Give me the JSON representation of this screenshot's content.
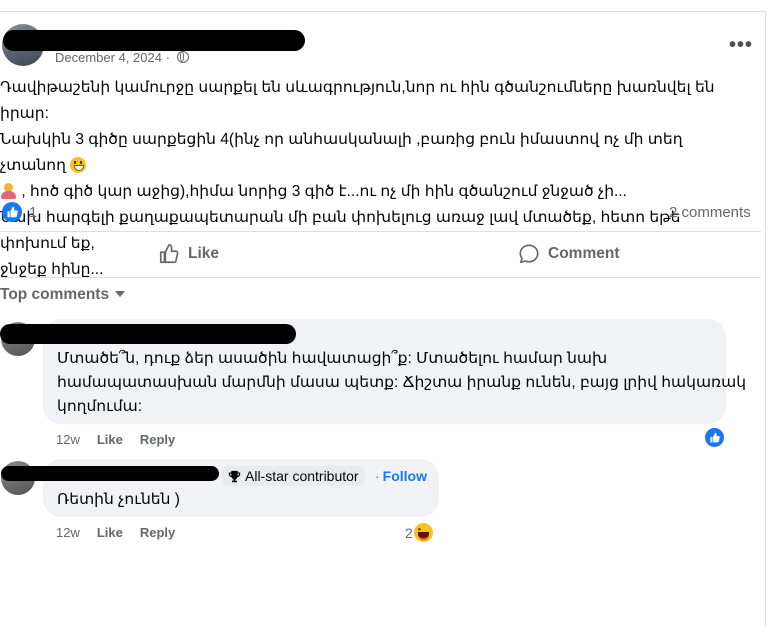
{
  "post": {
    "date": "December 4, 2024 ·",
    "more_label": "•••",
    "text_lines": [
      "Դավիթաշենի կամուրջը սարքել են սևագրություն,նոր ու հին գծանշումները խառնվել են իրար:",
      "Նախկին 3 գիծը սարքեցին 4(ինչ որ անհասկանալի ,բառից բուն իմաստով ոչ մի տեղ չտանող",
      ", հոծ գիծ կար աջից),հիմա նորից 3 գիծ է...ու ոչ մի հին գծանշում ջնջած չի...",
      "Նախ հարգելի քաղաքապետարան մի բան փոխելուց առաջ լավ մտածեք, հետո եթե փոխում եք,",
      "ջնջեք հինը..."
    ],
    "reaction_count": "1",
    "comments_count": "2 comments"
  },
  "actions": {
    "like_label": "Like",
    "comment_label": "Comment"
  },
  "comments_header": "Top comments",
  "comments": [
    {
      "lines": [
        "Մտածե՞ն, դուք ձեր ասածին հավատացի՞ք: Մտածելու համար նախ",
        "համապատասխան մարմնի մասա պետք: Ճիշտա իրանք ունեն, բայց լրիվ հակառակ",
        "կողմումա:"
      ],
      "time": "12w",
      "like_label": "Like",
      "reply_label": "Reply"
    },
    {
      "badge": "All-star contributor",
      "follow_label": "Follow",
      "lines": [
        "Ռետին չունեն )"
      ],
      "time": "12w",
      "like_label": "Like",
      "reply_label": "Reply",
      "reaction_count": "2"
    }
  ],
  "colors": {
    "accent": "#1877f2",
    "secondary_text": "#65676b",
    "bubble": "#f0f2f5"
  }
}
